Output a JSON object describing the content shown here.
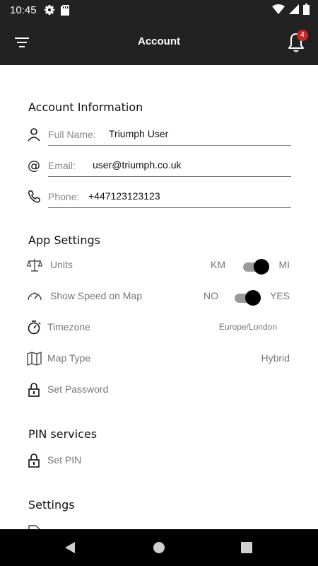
{
  "status_bar": {
    "time": "10:45",
    "icons": [
      "gear-icon",
      "sd-card-icon",
      "wifi-icon",
      "signal-icon",
      "battery-icon"
    ]
  },
  "header": {
    "title": "Account",
    "notification_count": "4",
    "background": "#222222"
  },
  "account_info": {
    "title": "Account Information",
    "full_name": {
      "label": "Full Name:",
      "value": "Triumph User",
      "icon": "person-icon"
    },
    "email": {
      "label": "Email:",
      "value": "user@triumph.co.uk",
      "icon": "at-icon"
    },
    "phone": {
      "label": "Phone:",
      "value": "+447123123123",
      "icon": "phone-icon"
    }
  },
  "app_settings": {
    "title": "App Settings",
    "units": {
      "label": "Units",
      "left_option": "KM",
      "right_option": "MI",
      "selected": "MI",
      "icon": "scale-icon"
    },
    "show_speed": {
      "label": "Show Speed on Map",
      "left_option": "NO",
      "right_option": "YES",
      "selected": "YES",
      "icon": "speedometer-icon"
    },
    "timezone": {
      "label": "Timezone",
      "value": "Europe/London",
      "icon": "stopwatch-icon"
    },
    "map_type": {
      "label": "Map Type",
      "value": "Hybrid",
      "icon": "map-icon"
    },
    "set_password": {
      "label": "Set Password",
      "icon": "lock-icon"
    }
  },
  "pin_services": {
    "title": "PIN services",
    "set_pin": {
      "label": "Set PIN",
      "icon": "lock-icon"
    }
  },
  "settings": {
    "title": "Settings",
    "terms": {
      "icon": "document-icon"
    }
  },
  "nav_bar": {
    "buttons": [
      "back-icon",
      "home-icon",
      "recents-icon"
    ]
  }
}
